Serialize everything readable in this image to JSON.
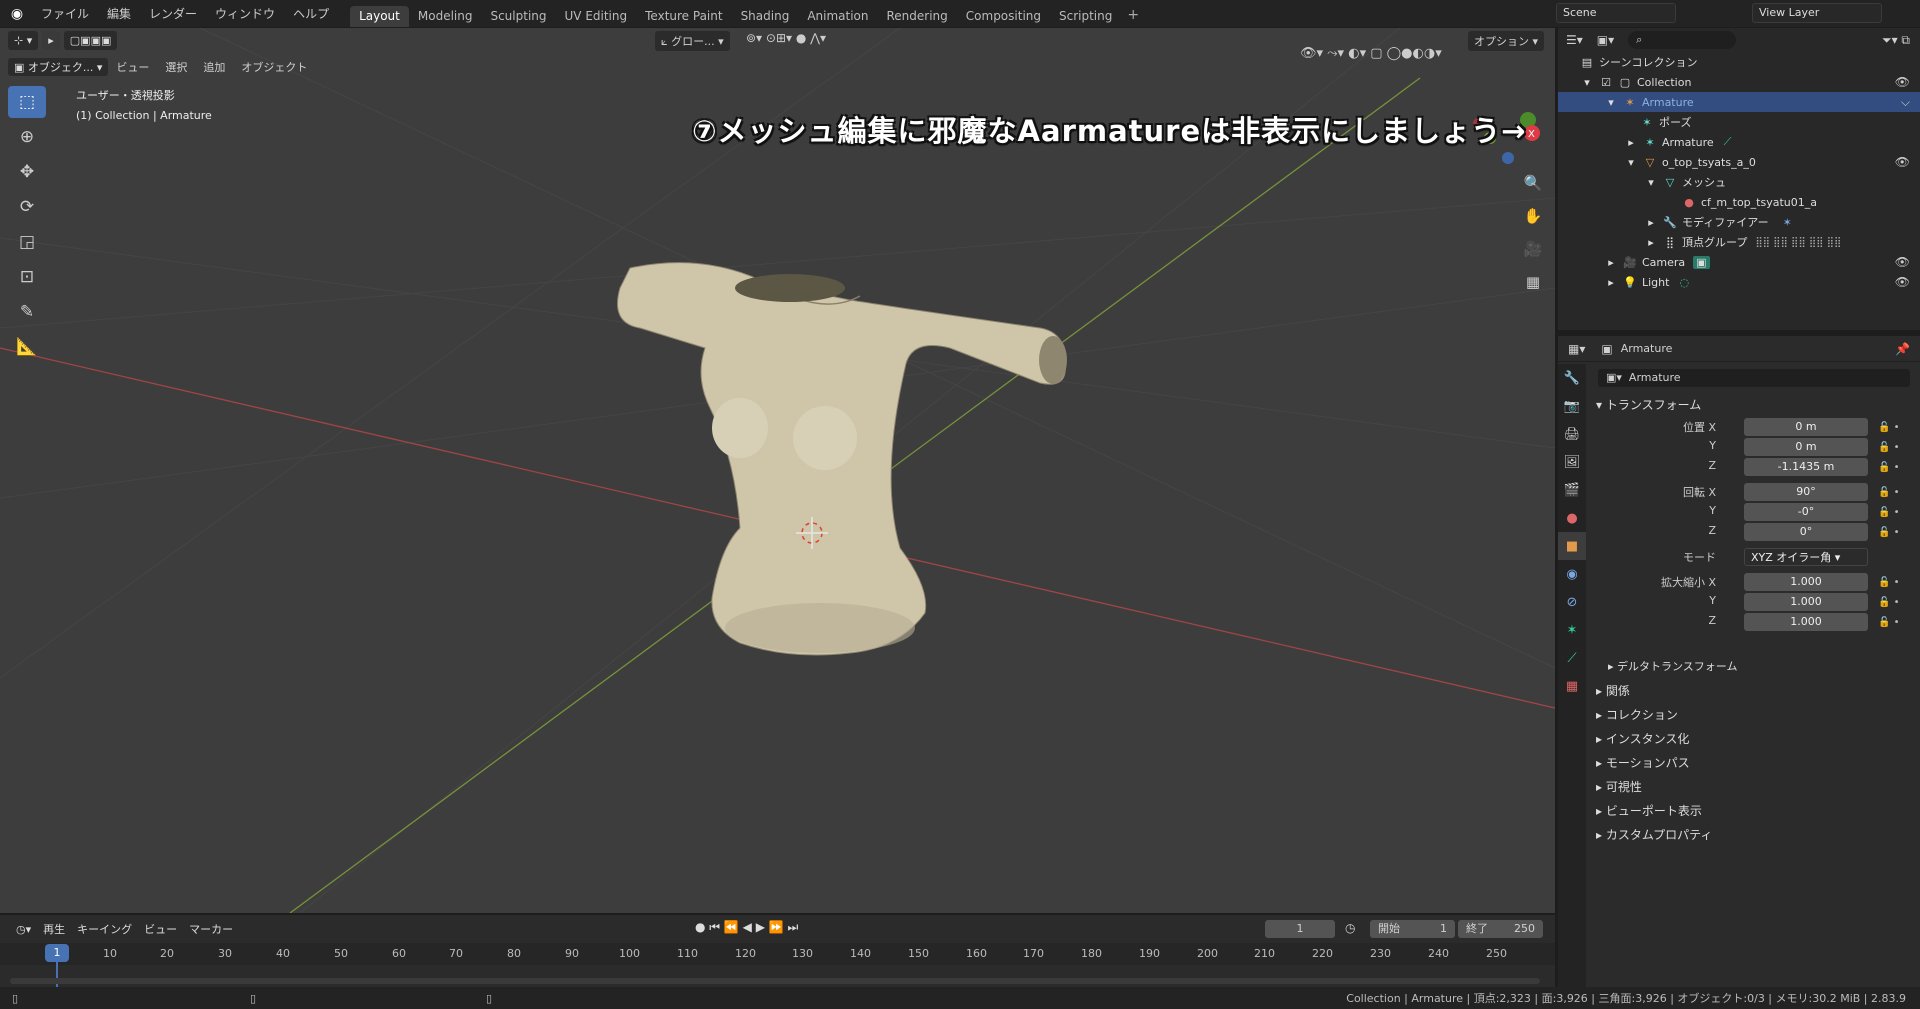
{
  "topbar": {
    "menu": [
      "ファイル",
      "編集",
      "レンダー",
      "ウィンドウ",
      "ヘルプ"
    ],
    "workspace_tabs": [
      "Layout",
      "Modeling",
      "Sculpting",
      "UV Editing",
      "Texture Paint",
      "Shading",
      "Animation",
      "Rendering",
      "Compositing",
      "Scripting"
    ],
    "active_tab": "Layout",
    "scene": "Scene",
    "view_layer": "View Layer"
  },
  "viewport": {
    "mode": "オブジェク...",
    "menu": [
      "ビュー",
      "選択",
      "追加",
      "オブジェクト"
    ],
    "orientation": "グロー...",
    "options": "オプション",
    "view_name": "ユーザー・透視投影",
    "context": "(1) Collection | Armature",
    "annotation": "⑦メッシュ編集に邪魔なAarmatureは非表示にしましょう→"
  },
  "outliner": {
    "title": "シーンコレクション",
    "rows": [
      {
        "label": "Collection",
        "indent": 0
      },
      {
        "label": "Armature",
        "indent": 1
      },
      {
        "label": "ポーズ",
        "indent": 2
      },
      {
        "label": "Armature",
        "indent": 2
      },
      {
        "label": "o_top_tsyats_a_0",
        "indent": 2
      },
      {
        "label": "メッシュ",
        "indent": 3
      },
      {
        "label": "cf_m_top_tsyatu01_a",
        "indent": 4
      },
      {
        "label": "モディファイアー",
        "indent": 3
      },
      {
        "label": "頂点グループ",
        "indent": 3
      },
      {
        "label": "Camera",
        "indent": 1
      },
      {
        "label": "Light",
        "indent": 1
      }
    ]
  },
  "properties": {
    "object_name": "Armature",
    "name_field": "Armature",
    "transform_title": "トランスフォーム",
    "location_label": "位置 X",
    "location": [
      "0 m",
      "0 m",
      "-1.1435 m"
    ],
    "rotation_label": "回転 X",
    "rotation": [
      "90°",
      "-0°",
      "0°"
    ],
    "mode_label": "モード",
    "mode_value": "XYZ オイラー角",
    "scale_label": "拡大縮小 X",
    "scale": [
      "1.000",
      "1.000",
      "1.000"
    ],
    "axis_y": "Y",
    "axis_z": "Z",
    "delta": "デルタトランスフォーム",
    "sections": [
      "関係",
      "コレクション",
      "インスタンス化",
      "モーションパス",
      "可視性",
      "ビューポート表示",
      "カスタムプロパティ"
    ]
  },
  "timeline": {
    "menu": [
      "再生",
      "キーイング",
      "ビュー",
      "マーカー"
    ],
    "current_frame": "1",
    "start_label": "開始",
    "start": "1",
    "end_label": "終了",
    "end": "250",
    "ticks": [
      "1",
      "10",
      "20",
      "30",
      "40",
      "50",
      "60",
      "70",
      "80",
      "90",
      "100",
      "110",
      "120",
      "130",
      "140",
      "150",
      "160",
      "170",
      "180",
      "190",
      "200",
      "210",
      "220",
      "230",
      "240",
      "250"
    ]
  },
  "statusbar": {
    "text": "Collection | Armature | 頂点:2,323 | 面:3,926 | 三角面:3,926 | オブジェクト:0/3 | メモリ:30.2 MiB | 2.83.9"
  }
}
